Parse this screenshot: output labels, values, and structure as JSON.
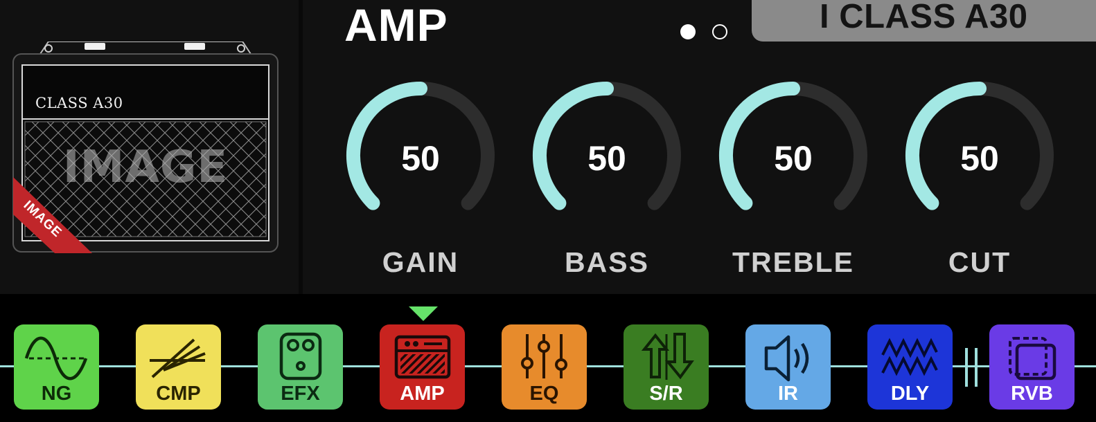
{
  "image_panel": {
    "cabinet_brand": "CLASS A30",
    "watermark": "IMAGE",
    "ribbon": "IMAGE"
  },
  "header": {
    "title": "AMP",
    "model_name": "I CLASS A30",
    "page_dots": {
      "count": 2,
      "active_index": 0
    }
  },
  "knobs": [
    {
      "label": "GAIN",
      "value": "50"
    },
    {
      "label": "BASS",
      "value": "50"
    },
    {
      "label": "TREBLE",
      "value": "50"
    },
    {
      "label": "CUT",
      "value": "50"
    }
  ],
  "chain": {
    "selected": "AMP",
    "blocks": [
      {
        "label": "NG",
        "icon": "sine-wave-icon",
        "color": "#5fd34a",
        "text_color": "#0d2a08"
      },
      {
        "label": "CMP",
        "icon": "compressor-icon",
        "color": "#f0e05a",
        "text_color": "#2a2400"
      },
      {
        "label": "EFX",
        "icon": "pedal-icon",
        "color": "#5cc46f",
        "text_color": "#0b2a12"
      },
      {
        "label": "AMP",
        "icon": "amp-head-icon",
        "color": "#c8231f",
        "text_color": "#ffffff"
      },
      {
        "label": "EQ",
        "icon": "eq-sliders-icon",
        "color": "#e78b2c",
        "text_color": "#2a1400"
      },
      {
        "label": "S/R",
        "icon": "send-return-icon",
        "color": "#3a7d22",
        "text_color": "#ffffff"
      },
      {
        "label": "IR",
        "icon": "speaker-icon",
        "color": "#64a8e6",
        "text_color": "#ffffff"
      },
      {
        "label": "DLY",
        "icon": "delay-wave-icon",
        "color": "#1d35d8",
        "text_color": "#ffffff"
      },
      {
        "label": "RVB",
        "icon": "reverb-icon",
        "color": "#6a3be6",
        "text_color": "#ffffff"
      }
    ]
  },
  "colors": {
    "knob_active": "#a3e8e4",
    "knob_track": "#2d2d2d",
    "chain_line": "#9fe0dd",
    "selection_marker": "#66e36a",
    "model_badge": "#8a8a8a"
  }
}
